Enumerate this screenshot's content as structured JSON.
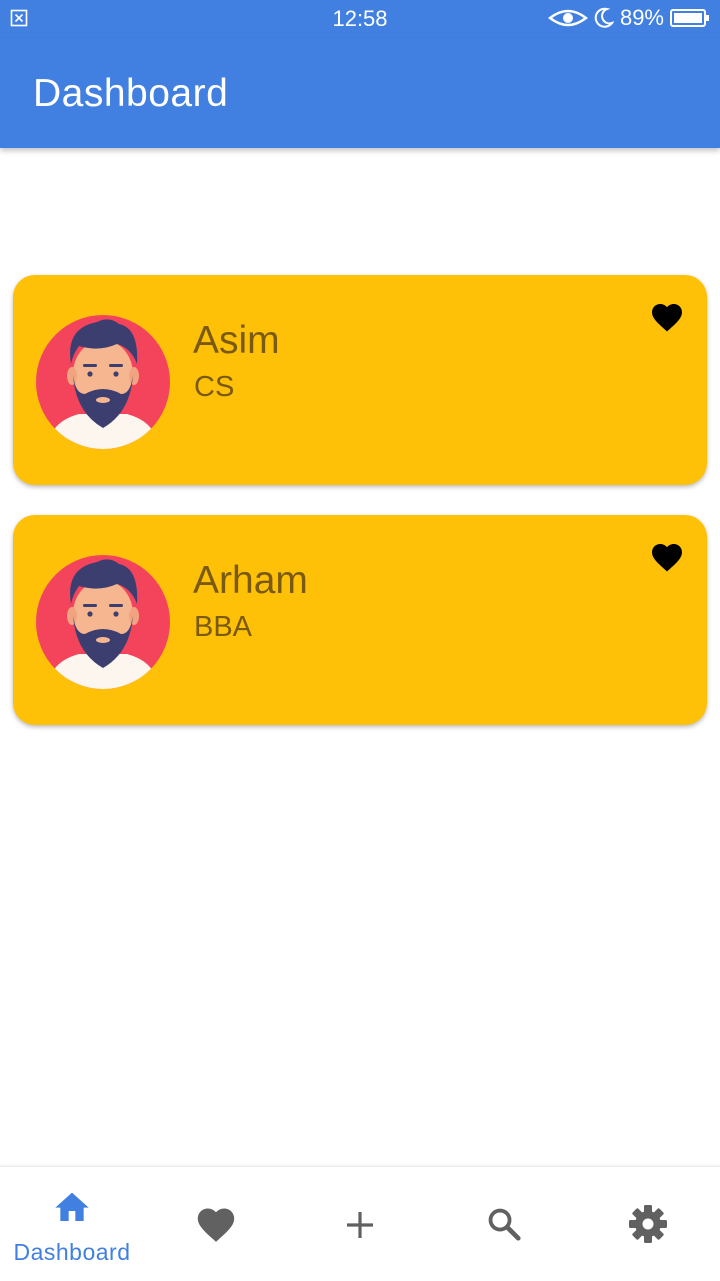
{
  "status_bar": {
    "time": "12:58",
    "battery_percent": "89%",
    "icons": [
      "close-box-icon",
      "eye-icon",
      "moon-icon",
      "battery-icon"
    ]
  },
  "app_bar": {
    "title": "Dashboard",
    "color": "#4180e0"
  },
  "cards": [
    {
      "name": "Asim",
      "subtitle": "CS",
      "avatar_icon": "bearded-man-avatar",
      "favorite_icon": "heart-icon"
    },
    {
      "name": "Arham",
      "subtitle": "BBA",
      "avatar_icon": "bearded-man-avatar",
      "favorite_icon": "heart-icon"
    }
  ],
  "card_color": "#ffc107",
  "bottom_nav": {
    "items": [
      {
        "icon": "home-icon",
        "label": "Dashboard",
        "active": true
      },
      {
        "icon": "heart-icon",
        "label": "",
        "active": false
      },
      {
        "icon": "plus-icon",
        "label": "",
        "active": false
      },
      {
        "icon": "search-icon",
        "label": "",
        "active": false
      },
      {
        "icon": "gear-icon",
        "label": "",
        "active": false
      }
    ],
    "active_color": "#4180e0",
    "inactive_color": "#616161"
  }
}
